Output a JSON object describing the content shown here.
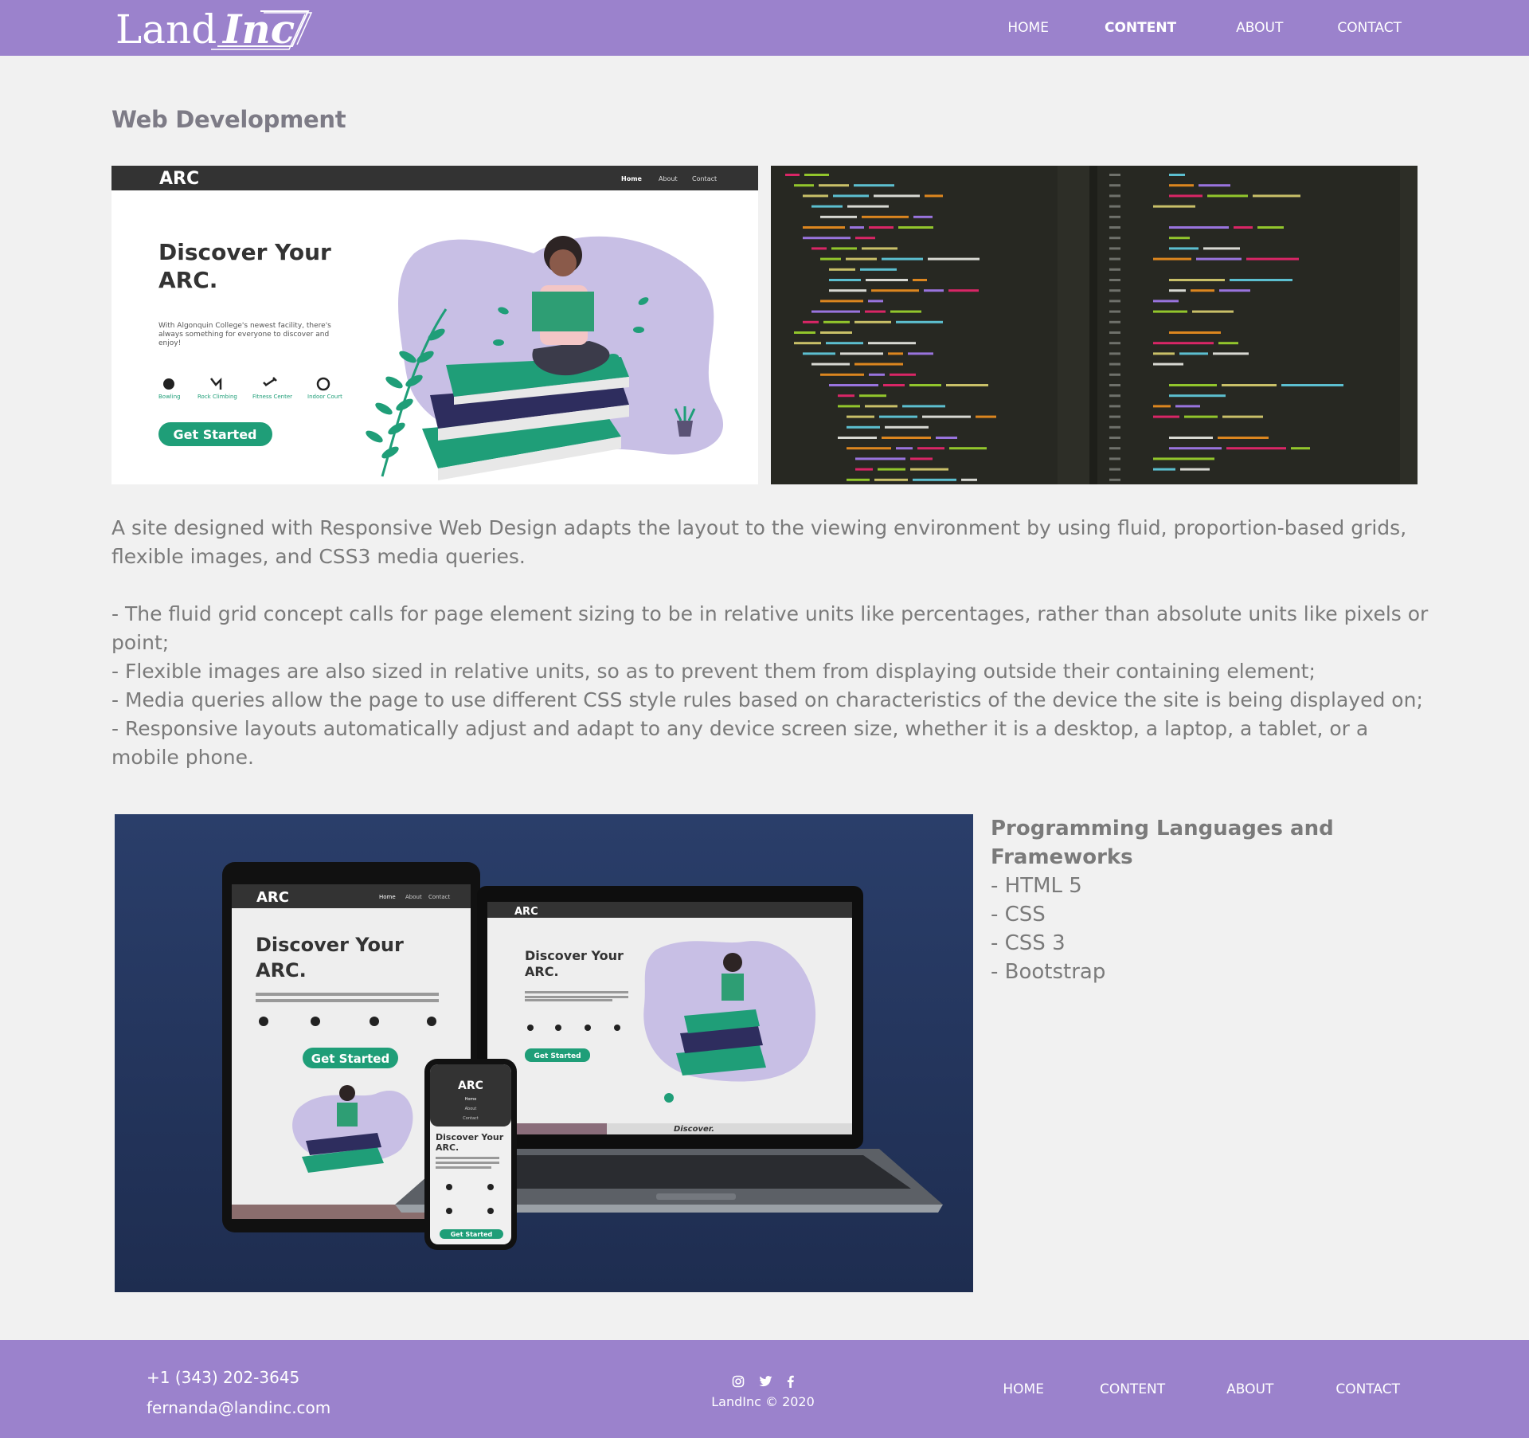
{
  "header": {
    "logo_text": "LandInc",
    "nav": [
      {
        "label": "HOME",
        "active": false
      },
      {
        "label": "CONTENT",
        "active": true
      },
      {
        "label": "ABOUT",
        "active": false
      },
      {
        "label": "CONTACT",
        "active": false
      }
    ]
  },
  "main": {
    "title": "Web Development",
    "arc_mock": {
      "logo": "ARC",
      "nav": [
        "Home",
        "About",
        "Contact"
      ],
      "heading_line1": "Discover Your",
      "heading_line2": "ARC.",
      "body": "With Algonquin College's newest facility, there's always something for everyone to discover and enjoy!",
      "icons": [
        "Bowling",
        "Rock Climbing",
        "Fitness Center",
        "Indoor Court"
      ],
      "button": "Get Started"
    },
    "description": {
      "intro": "A site designed with Responsive Web Design adapts the layout to the viewing environment by using fluid, proportion-based grids, flexible images, and CSS3 media queries.",
      "points": [
        "- The fluid grid concept calls for page element sizing to be in relative units like percentages, rather than absolute units like pixels or point;",
        "- Flexible images are also sized in relative units, so as to prevent them from displaying outside their containing element;",
        "- Media queries allow the page to use different CSS style rules based on characteristics of the device the site is being displayed on;",
        "- Responsive layouts automatically adjust and adapt to any device screen size, whether it is a desktop, a laptop, a tablet, or a mobile phone."
      ]
    },
    "languages": {
      "heading": "Programming Languages and Frameworks",
      "items": [
        "- HTML 5",
        "- CSS",
        "- CSS 3",
        "- Bootstrap"
      ]
    },
    "device_mock": {
      "laptop_footer": "Discover."
    }
  },
  "footer": {
    "phone": "+1 (343) 202-3645",
    "email": "fernanda@landinc.com",
    "social": [
      "instagram-icon",
      "twitter-icon",
      "facebook-icon"
    ],
    "copyright": "LandInc © 2020",
    "nav": [
      "HOME",
      "CONTENT",
      "ABOUT",
      "CONTACT"
    ]
  },
  "colors": {
    "brand": "#9b82cc",
    "page_bg": "#f1f1f1",
    "text": "#7a7a7a",
    "arc_green": "#1f9e78",
    "devices_bg": "#22345b"
  }
}
